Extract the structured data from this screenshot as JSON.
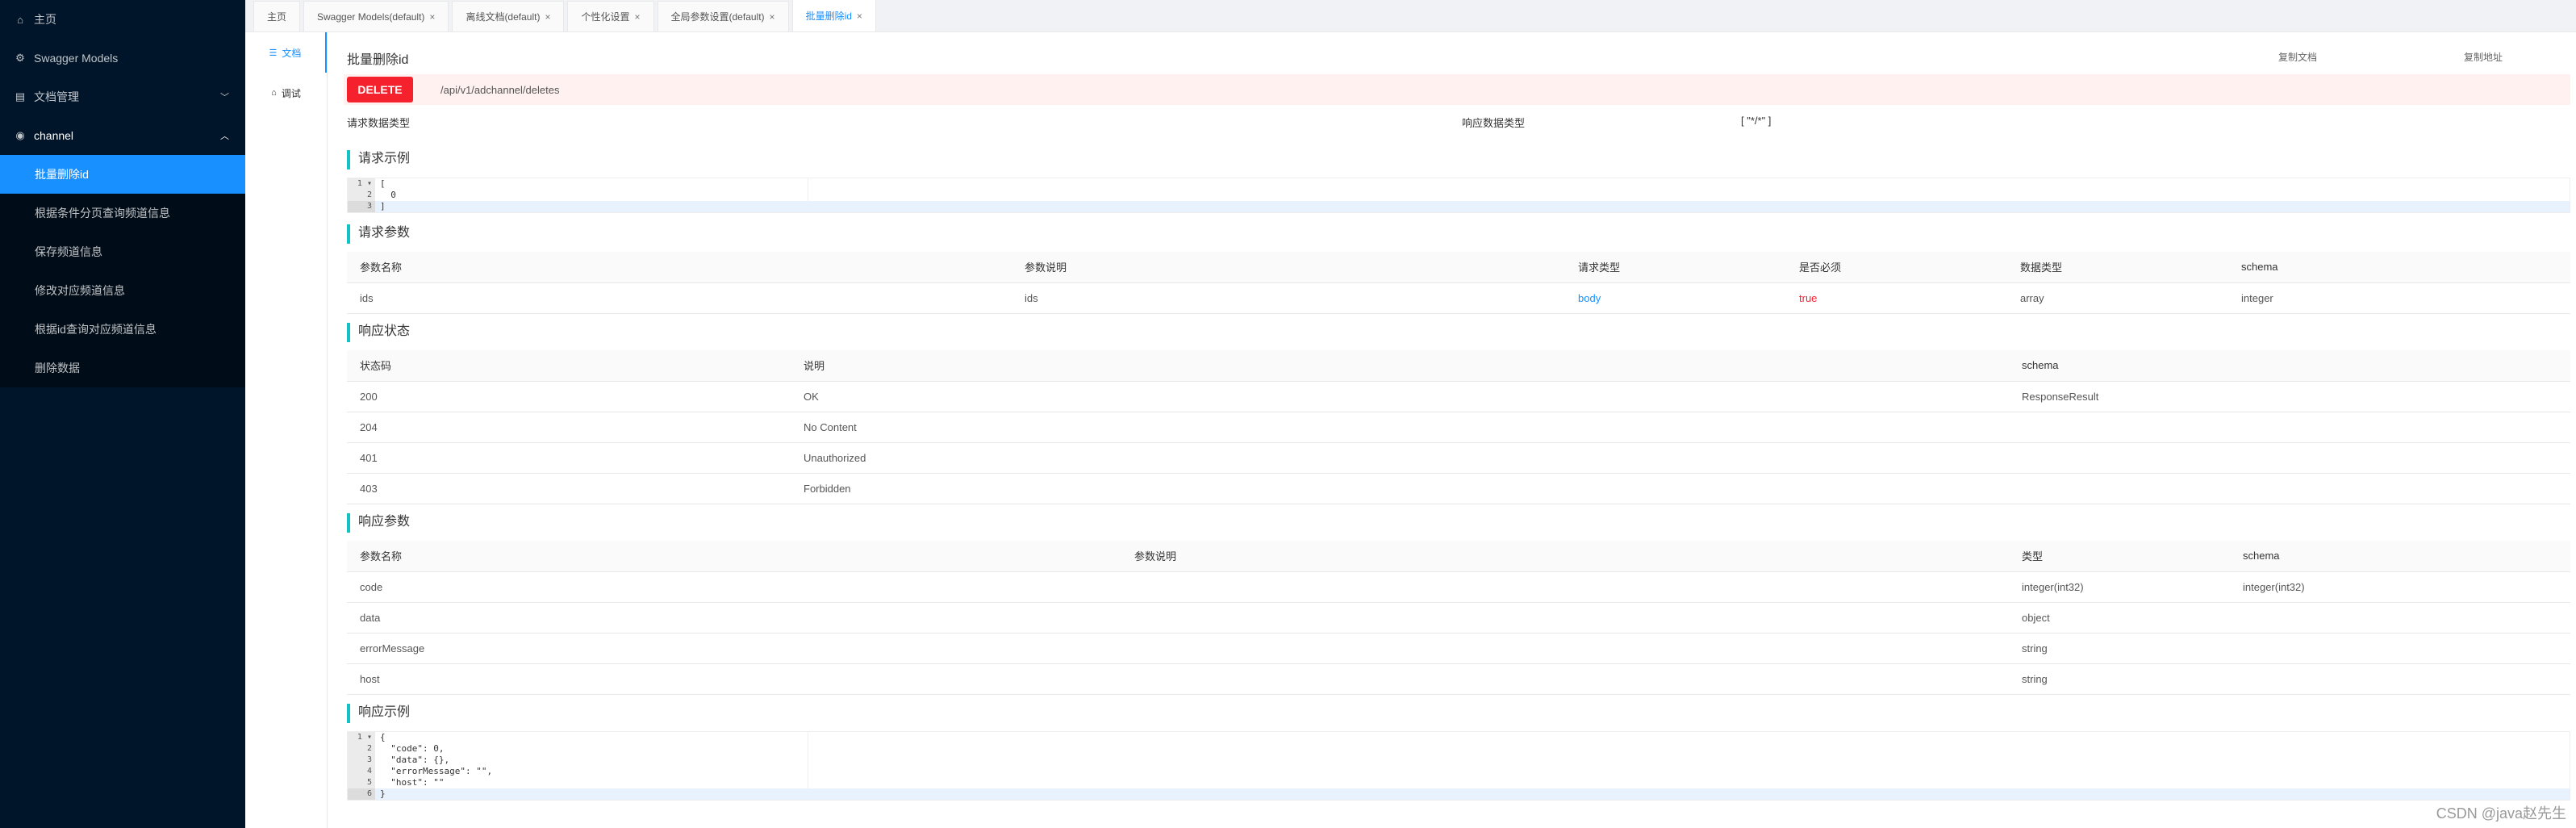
{
  "sidebar": {
    "items": [
      {
        "label": "主页",
        "icon": "home-icon"
      },
      {
        "label": "Swagger Models",
        "icon": "settings-icon"
      },
      {
        "label": "文档管理",
        "icon": "folder-icon"
      },
      {
        "label": "channel",
        "icon": "eye-icon"
      }
    ],
    "channel_children": [
      {
        "label": "批量删除id"
      },
      {
        "label": "根据条件分页查询频道信息"
      },
      {
        "label": "保存频道信息"
      },
      {
        "label": "修改对应频道信息"
      },
      {
        "label": "根据id查询对应频道信息"
      },
      {
        "label": "删除数据"
      }
    ],
    "active_color": "#1890ff"
  },
  "tabs": [
    {
      "label": "主页",
      "closable": false
    },
    {
      "label": "Swagger Models(default)",
      "closable": true
    },
    {
      "label": "离线文档(default)",
      "closable": true
    },
    {
      "label": "个性化设置",
      "closable": true
    },
    {
      "label": "全局参数设置(default)",
      "closable": true
    },
    {
      "label": "批量删除id",
      "closable": true,
      "active": true
    }
  ],
  "vtabs": [
    {
      "label": "文档",
      "icon": "doc-icon"
    },
    {
      "label": "调试",
      "icon": "home-icon"
    }
  ],
  "api": {
    "title": "批量删除id",
    "copy_doc": "复制文档",
    "copy_url": "复制地址",
    "method": "DELETE",
    "url": "/api/v1/adchannel/deletes",
    "request_type_label": "请求数据类型",
    "response_type_label": "响应数据类型",
    "response_type_value": "[ \"*/*\" ]"
  },
  "sections": {
    "request_example": "请求示例",
    "request_params": "请求参数",
    "response_status": "响应状态",
    "response_params": "响应参数",
    "response_example": "响应示例"
  },
  "request_example_lines": [
    {
      "n": "1",
      "fold": "▾",
      "text": "["
    },
    {
      "n": "2",
      "fold": "",
      "text": "  0"
    },
    {
      "n": "3",
      "fold": "",
      "text": "]"
    }
  ],
  "request_params": {
    "headers": [
      "参数名称",
      "参数说明",
      "请求类型",
      "是否必须",
      "数据类型",
      "schema"
    ],
    "rows": [
      [
        "ids",
        "ids",
        "body",
        "true",
        "array",
        "integer"
      ]
    ]
  },
  "response_status": {
    "headers": [
      "状态码",
      "说明",
      "schema"
    ],
    "rows": [
      [
        "200",
        "OK",
        "ResponseResult"
      ],
      [
        "204",
        "No Content",
        ""
      ],
      [
        "401",
        "Unauthorized",
        ""
      ],
      [
        "403",
        "Forbidden",
        ""
      ]
    ]
  },
  "response_params": {
    "headers": [
      "参数名称",
      "参数说明",
      "类型",
      "schema"
    ],
    "rows": [
      [
        "code",
        "",
        "integer(int32)",
        "integer(int32)"
      ],
      [
        "data",
        "",
        "object",
        ""
      ],
      [
        "errorMessage",
        "",
        "string",
        ""
      ],
      [
        "host",
        "",
        "string",
        ""
      ]
    ]
  },
  "response_example_lines": [
    {
      "n": "1",
      "fold": "▾",
      "text": "{"
    },
    {
      "n": "2",
      "fold": "",
      "text": "  \"code\": 0,"
    },
    {
      "n": "3",
      "fold": "",
      "text": "  \"data\": {},"
    },
    {
      "n": "4",
      "fold": "",
      "text": "  \"errorMessage\": \"\","
    },
    {
      "n": "5",
      "fold": "",
      "text": "  \"host\": \"\""
    },
    {
      "n": "6",
      "fold": "",
      "text": "}"
    }
  ],
  "watermark": "CSDN @java赵先生"
}
